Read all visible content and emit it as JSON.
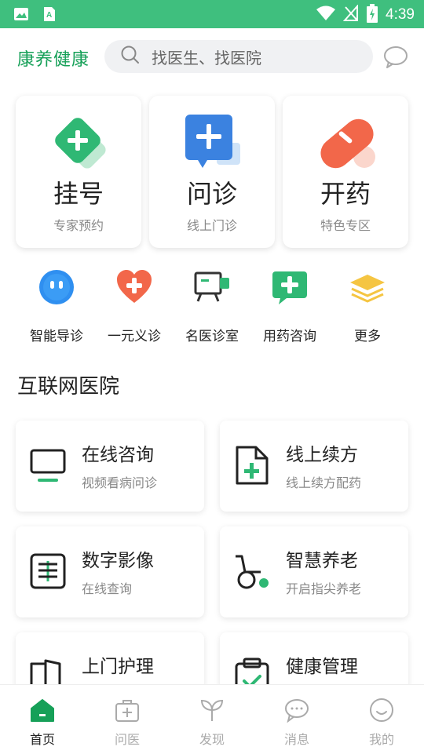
{
  "status_bar": {
    "time": "4:39"
  },
  "header": {
    "brand": "康养健康",
    "search_placeholder": "找医生、找医院"
  },
  "main_cards": [
    {
      "title": "挂号",
      "subtitle": "专家预约",
      "icon": "register-plus-icon"
    },
    {
      "title": "问诊",
      "subtitle": "线上门诊",
      "icon": "consult-chat-icon"
    },
    {
      "title": "开药",
      "subtitle": "特色专区",
      "icon": "pill-icon"
    }
  ],
  "quick_entries": [
    {
      "label": "智能导诊",
      "icon": "robot-face-icon"
    },
    {
      "label": "一元义诊",
      "icon": "heart-plus-icon"
    },
    {
      "label": "名医诊室",
      "icon": "video-board-icon"
    },
    {
      "label": "用药咨询",
      "icon": "chat-plus-icon"
    },
    {
      "label": "更多",
      "icon": "layers-icon"
    }
  ],
  "section": {
    "title": "互联网医院"
  },
  "services": [
    {
      "title": "在线咨询",
      "subtitle": "视频看病问诊",
      "icon": "monitor-icon"
    },
    {
      "title": "线上续方",
      "subtitle": "线上续方配药",
      "icon": "document-plus-icon"
    },
    {
      "title": "数字影像",
      "subtitle": "在线查询",
      "icon": "xray-icon"
    },
    {
      "title": "智慧养老",
      "subtitle": "开启指尖养老",
      "icon": "wheelchair-icon"
    },
    {
      "title": "上门护理",
      "subtitle": "",
      "icon": "door-icon"
    },
    {
      "title": "健康管理",
      "subtitle": "",
      "icon": "clipboard-check-icon"
    }
  ],
  "tabbar": [
    {
      "label": "首页",
      "icon": "home-icon",
      "active": true
    },
    {
      "label": "问医",
      "icon": "medical-kit-icon",
      "active": false
    },
    {
      "label": "发现",
      "icon": "sprout-icon",
      "active": false
    },
    {
      "label": "消息",
      "icon": "message-icon",
      "active": false
    },
    {
      "label": "我的",
      "icon": "smile-face-icon",
      "active": false
    }
  ],
  "colors": {
    "brand_green": "#16a058",
    "status_bar": "#3fbf7e",
    "accent_red": "#f2674a",
    "accent_blue": "#3b82e0"
  }
}
